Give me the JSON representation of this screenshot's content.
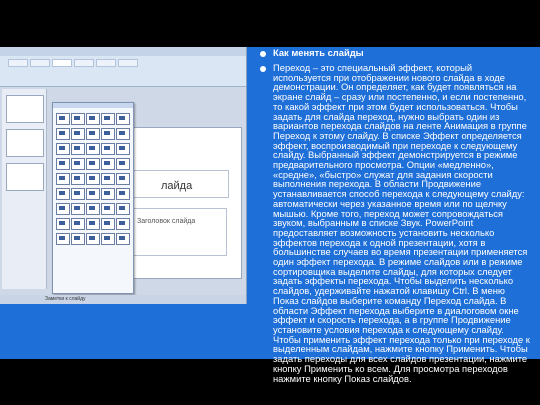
{
  "slide": {
    "heading": "Как менять слайды",
    "body": "Переход – это специальный эффект, который используется при отображении нового слайда в ходе демонстрации. Он определяет, как будет появляться на экране слайд – сразу или постепенно, и если постепенно, то какой эффект при этом будет использоваться. Чтобы задать для слайда переход, нужно выбрать один из вариантов перехода слайдов на ленте Анимация в группе Переход к этому слайду. В списке Эффект определяется эффект, воспроизводимый при переходе к следующему слайду. Выбранный эффект демонстрируется в режиме предварительного просмотра. Опции «медленно», «средне», «быстро» служат для задания скорости выполнения перехода. В области Продвижение устанавливается способ перехода к следующему слайду: автоматически через указанное время или по щелчку мышью. Кроме того, переход может сопровождаться звуком, выбранным в списке Звук. PowerPoint предоставляет возможность установить несколько эффектов перехода к одной презентации, хотя в большинстве случаев во время презентации применяется один эффект перехода. В режиме слайдов или в режиме сортировщика выделите слайды, для которых следует задать эффекты перехода. Чтобы выделить несколько слайдов, удерживайте нажатой клавишу Ctrl. В меню Показ слайдов выберите команду Переход слайда. В области Эффект перехода выберите в диалоговом окне эффект и скорость перехода, а в группе Продвижение установите условия перехода к следующему слайду. Чтобы применить эффект перехода только при переходе к выделенным слайдам, нажмите кнопку Применить. Чтобы задать переходы для всех слайдов презентации, нажмите кнопку Применить ко всем. Для просмотра переходов нажмите кнопку Показ слайдов."
  },
  "screenshot": {
    "canvas_title": "лайда",
    "canvas_subtitle": "Заголовок слайда",
    "status_text": "Заметки к слайду"
  }
}
